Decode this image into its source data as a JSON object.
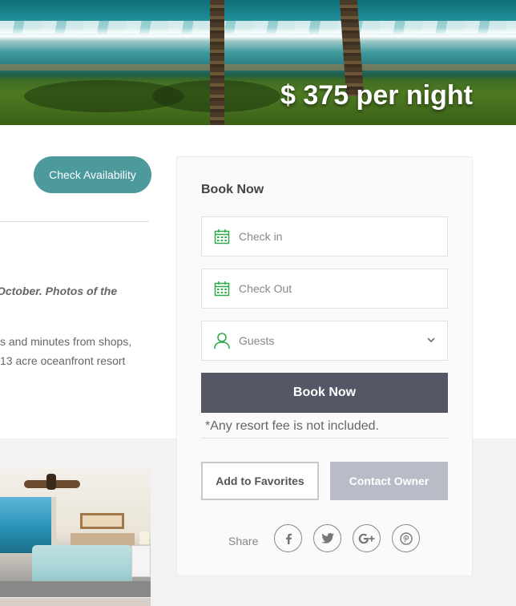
{
  "hero": {
    "price": "$ 375 per night"
  },
  "left": {
    "check_availability_label": "Check Availability",
    "italic_text": "October. Photos of the",
    "description_lines": [
      "s and minutes from shops,",
      "13 acre oceanfront resort"
    ]
  },
  "booking": {
    "title": "Book Now",
    "check_in_placeholder": "Check in",
    "check_out_placeholder": "Check Out",
    "guests_placeholder": "Guests",
    "book_button_label": "Book Now",
    "fee_note": "*Any resort fee is not included.",
    "favorites_label": "Add to Favorites",
    "contact_label": "Contact Owner",
    "share_label": "Share",
    "social_icons": [
      "facebook-icon",
      "twitter-icon",
      "google-plus-icon",
      "pinterest-icon"
    ]
  },
  "colors": {
    "accent_teal": "#4c9a9c",
    "book_button": "#535766",
    "contact_button": "#b8bcc6",
    "icon_green": "#2eaa4a"
  }
}
